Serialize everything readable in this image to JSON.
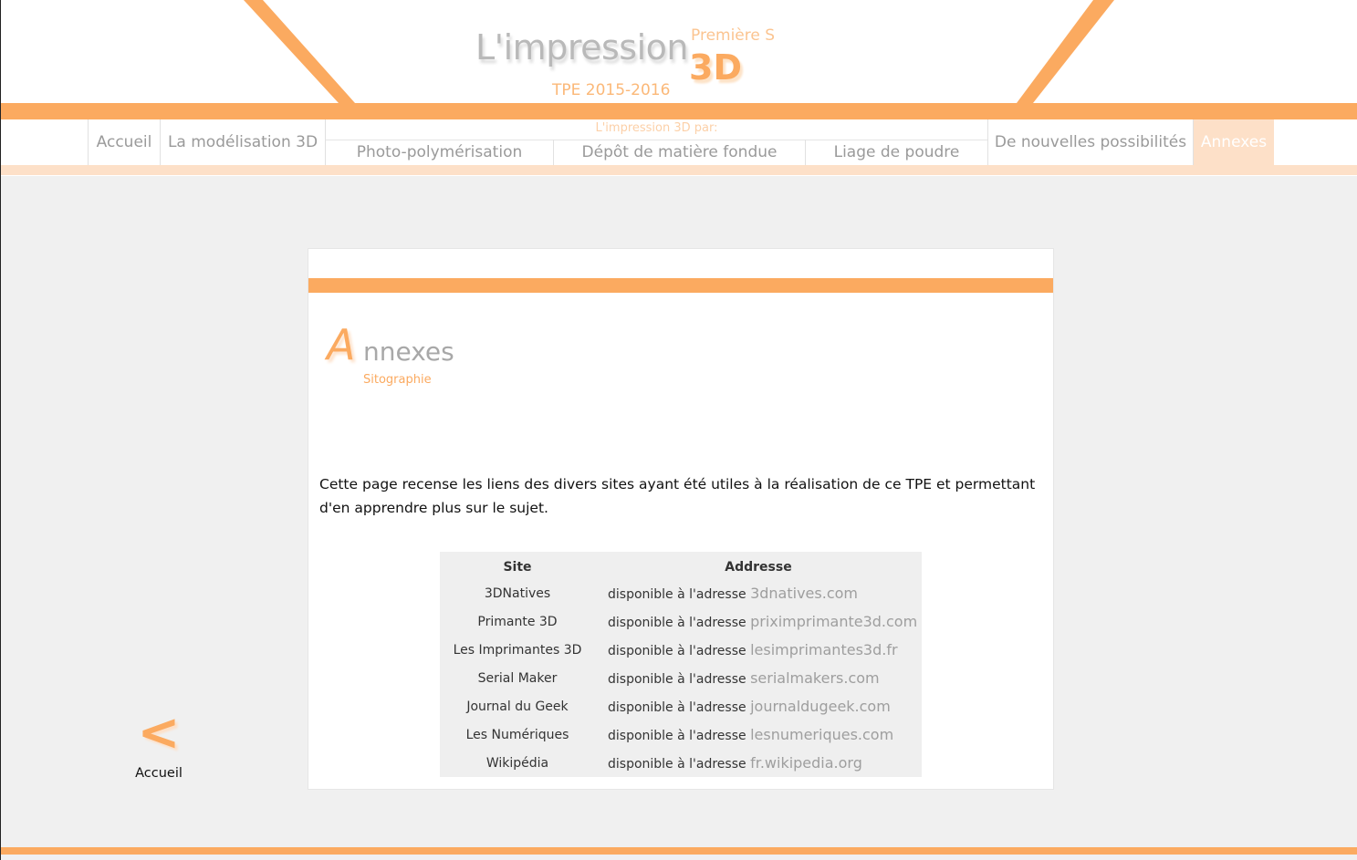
{
  "header": {
    "title": "L'impression",
    "subtitle": "TPE 2015-2016",
    "class_label": "Première S",
    "big_3d": "3D"
  },
  "nav": {
    "items": [
      {
        "label": "Accueil"
      },
      {
        "label": "La modélisation 3D"
      }
    ],
    "group_label": "L'impression 3D par:",
    "group_items": [
      {
        "label": "Photo-polymérisation"
      },
      {
        "label": "Dépôt de matière fondue"
      },
      {
        "label": "Liage de poudre"
      }
    ],
    "trailing": [
      {
        "label": "De nouvelles possibilités"
      },
      {
        "label": "Annexes"
      }
    ],
    "active": "Annexes"
  },
  "section": {
    "title_initial": "A",
    "title_rest": "nnexes",
    "subtitle": "Sitographie"
  },
  "intro": "Cette page recense les liens des divers sites ayant été utiles à la réalisation de ce TPE et permettant d'en apprendre plus sur le sujet.",
  "table": {
    "headers": [
      "Site",
      "Addresse"
    ],
    "prefix": "disponible à l'adresse",
    "rows": [
      {
        "site": "3DNatives",
        "url": "3dnatives.com"
      },
      {
        "site": "Primante 3D",
        "url": "priximprimante3d.com"
      },
      {
        "site": "Les Imprimantes 3D",
        "url": "lesimprimantes3d.fr"
      },
      {
        "site": "Serial Maker",
        "url": "serialmakers.com"
      },
      {
        "site": "Journal du Geek",
        "url": "journaldugeek.com"
      },
      {
        "site": "Les Numériques",
        "url": "lesnumeriques.com"
      },
      {
        "site": "Wikipédia",
        "url": "fr.wikipedia.org"
      }
    ]
  },
  "back": {
    "arrow": "<",
    "label": "Accueil"
  },
  "colors": {
    "accent": "#fbaa60",
    "accent_light": "#fde0c8",
    "background": "#f0f0f0"
  }
}
